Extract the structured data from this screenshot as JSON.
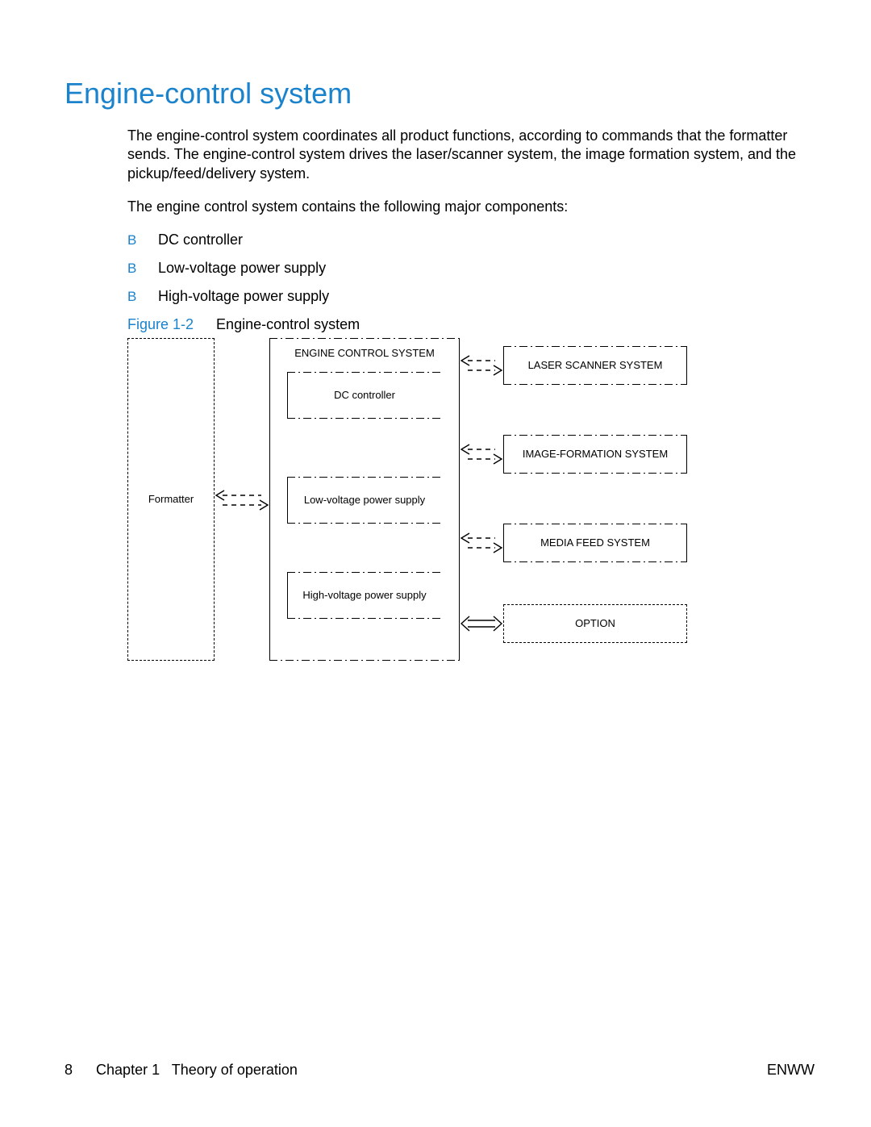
{
  "heading": "Engine-control system",
  "para1": "The engine-control system coordinates all product functions, according to commands that the formatter sends. The engine-control system drives the laser/scanner system, the image formation system, and the pickup/feed/delivery system.",
  "para2": "The engine control system contains the following major components:",
  "bullets": {
    "marker": "B",
    "items": [
      "DC controller",
      "Low-voltage power supply",
      "High-voltage power supply"
    ]
  },
  "figure": {
    "label": "Figure 1-2",
    "caption": "Engine-control system"
  },
  "diagram": {
    "formatter": "Formatter",
    "engine_title": "ENGINE CONTROL SYSTEM",
    "dc": "DC controller",
    "lv": "Low-voltage power supply",
    "hv": "High-voltage power supply",
    "laser": "LASER SCANNER SYSTEM",
    "image": "IMAGE-FORMATION SYSTEM",
    "media": "MEDIA FEED SYSTEM",
    "option": "OPTION"
  },
  "footer": {
    "page": "8",
    "chapter": "Chapter 1",
    "chapter_title": "Theory of operation",
    "right": "ENWW"
  }
}
